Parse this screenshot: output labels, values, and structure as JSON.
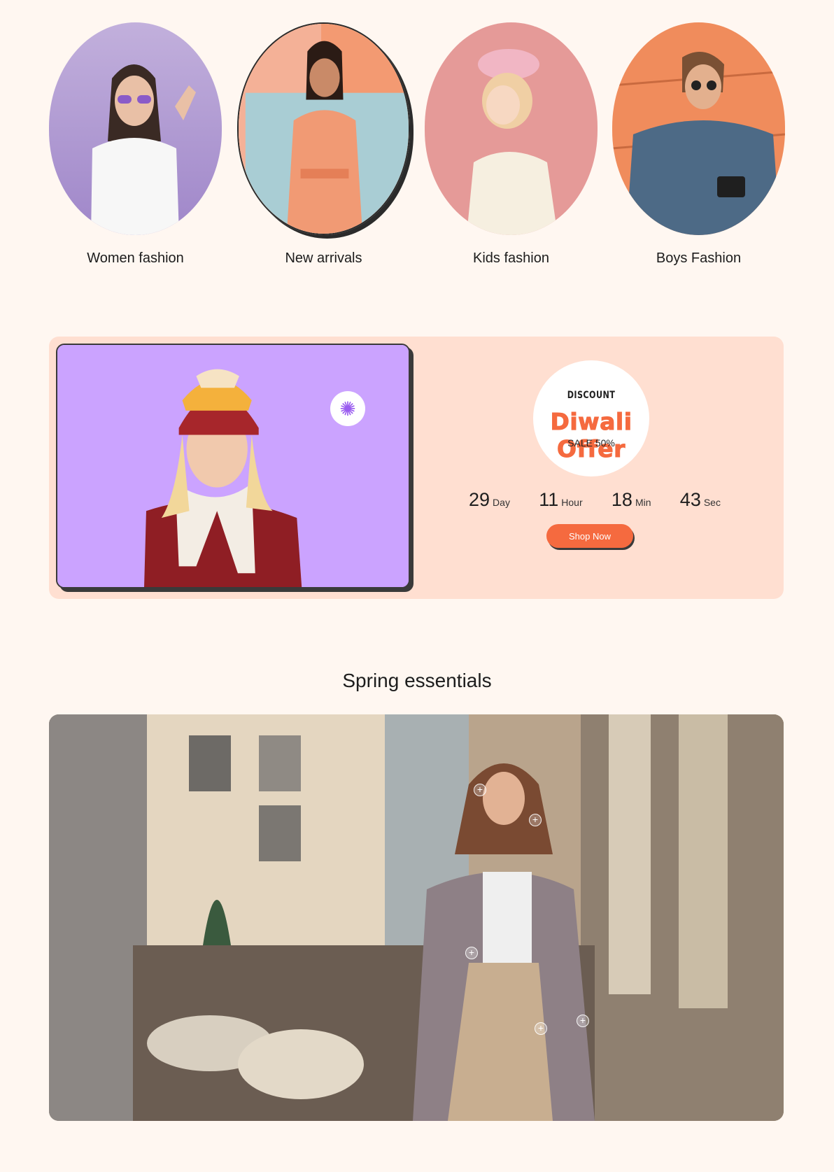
{
  "categories": [
    {
      "label": "Women fashion",
      "bg": "#b8a4d6",
      "icon": "woman-portrait-photo"
    },
    {
      "label": "New arrivals",
      "bg": "#f39a72",
      "icon": "satin-outfit-photo"
    },
    {
      "label": "Kids fashion",
      "bg": "#e59a98",
      "icon": "child-portrait-photo"
    },
    {
      "label": "Boys Fashion",
      "bg": "#f08c5c",
      "icon": "man-with-camera-photo"
    }
  ],
  "offer": {
    "image_bg": "#cba3ff",
    "sparkle_icon": "sparkle-icon",
    "badge_top": "DISCOUNT",
    "badge_title": "Diwali Offer",
    "badge_sale": "SALE 50%",
    "countdown": [
      {
        "value": "29",
        "unit": "Day"
      },
      {
        "value": "11",
        "unit": "Hour"
      },
      {
        "value": "18",
        "unit": "Min"
      },
      {
        "value": "43",
        "unit": "Sec"
      }
    ],
    "button_label": "Shop Now",
    "accent": "#f56a3f"
  },
  "spring": {
    "title": "Spring essentials",
    "hotspot_symbol": "+"
  }
}
